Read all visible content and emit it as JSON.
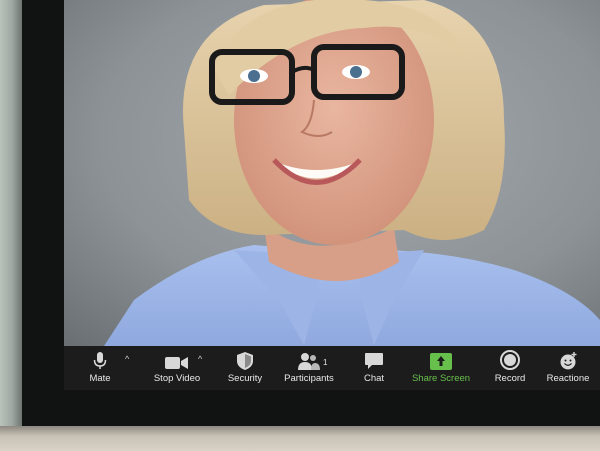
{
  "toolbar": {
    "mute": {
      "label": "Mate",
      "icon": "microphone-icon"
    },
    "video": {
      "label": "Stop Video",
      "icon": "video-camera-icon"
    },
    "security": {
      "label": "Security",
      "icon": "shield-icon"
    },
    "participants": {
      "label": "Participants",
      "icon": "participants-icon",
      "count": "1"
    },
    "chat": {
      "label": "Chat",
      "icon": "chat-bubble-icon"
    },
    "share": {
      "label": "Share Screen",
      "icon": "share-screen-icon"
    },
    "record": {
      "label": "Record",
      "icon": "record-icon"
    },
    "reactions": {
      "label": "Reactione",
      "icon": "reactions-icon"
    }
  },
  "colors": {
    "toolbar_bg": "#1c1c1c",
    "share_accent": "#68c04c",
    "label": "#e8e8e8"
  }
}
